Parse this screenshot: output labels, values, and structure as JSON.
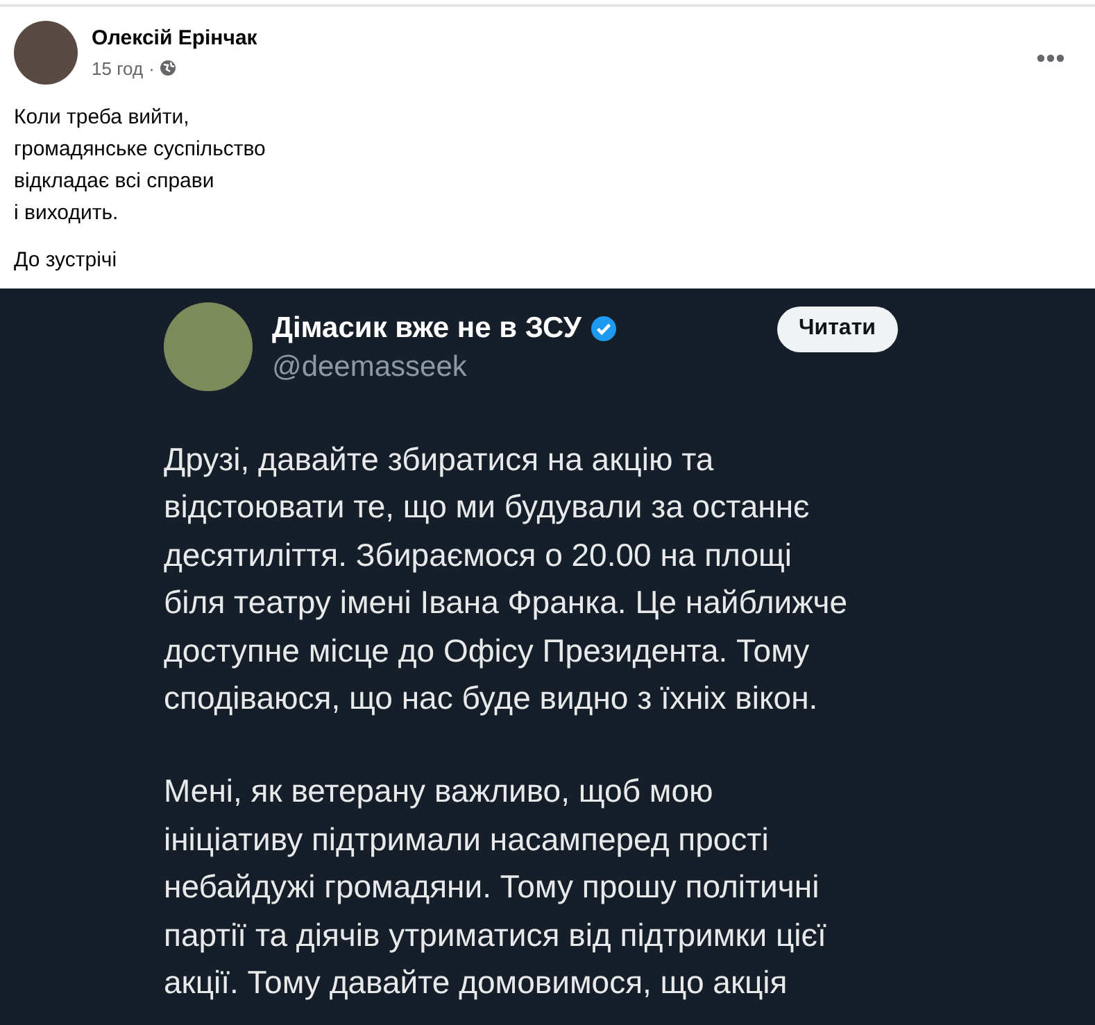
{
  "post": {
    "author": "Олексій Ерінчак",
    "time": "15 год",
    "separator": "·",
    "text": [
      "Коли треба вийти,",
      "громадянське суспільство",
      "відкладає всі справи",
      "і виходить."
    ],
    "closing": "До зустрічі"
  },
  "tweet": {
    "name": "Дімасик вже не в ЗСУ",
    "verified": true,
    "handle": "@deemasseek",
    "button": "Читати",
    "paragraphs": [
      [
        "Друзі, давайте збиратися на акцію та",
        "відстоювати те, що ми будували за останнє",
        "десятиліття. Збираємося о 20.00 на площі",
        "біля театру імені Івана Франка. Це найближче",
        "доступне місце до Офісу Президента. Тому",
        "сподіваюся, що нас буде видно з їхніх вікон."
      ],
      [
        "Мені, як ветерану важливо, щоб мою",
        "ініціативу підтримали насамперед прості",
        "небайдужі громадяни. Тому прошу політичні",
        "партії та діячів утриматися від підтримки цієї",
        "акції. Тому давайте домовимося, що акція"
      ]
    ]
  }
}
